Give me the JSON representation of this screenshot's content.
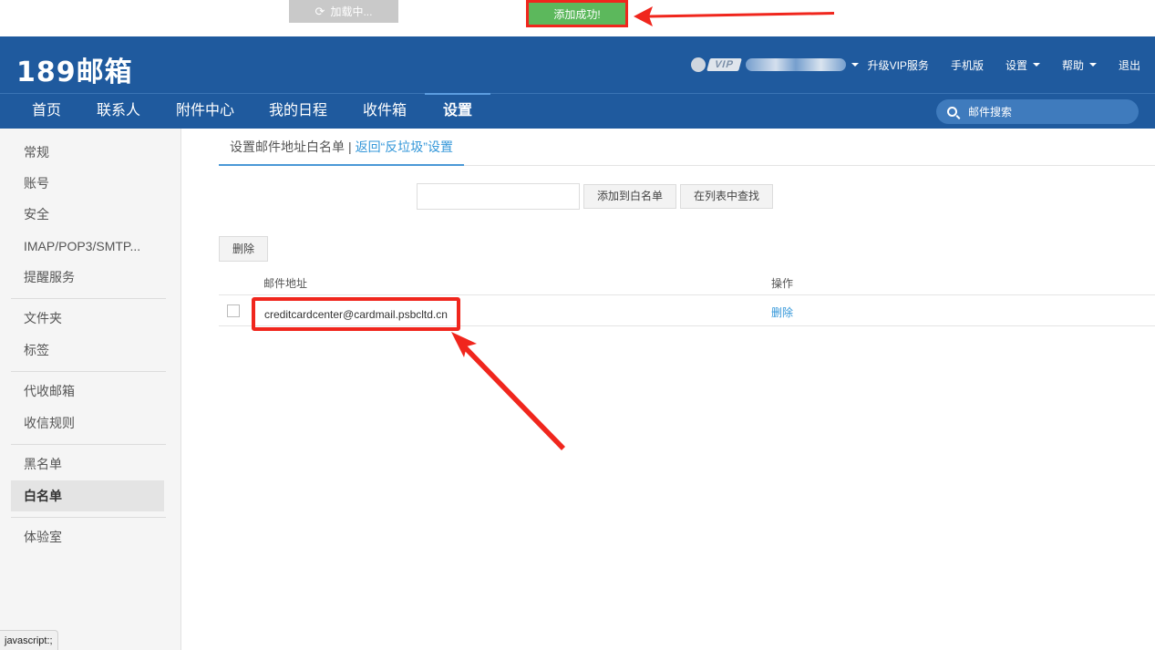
{
  "toast": {
    "loading": "加载中...",
    "success": "添加成功!"
  },
  "header": {
    "logo": "189邮箱",
    "vip_badge": "VIP",
    "links": [
      "升级VIP服务",
      "手机版",
      "设置",
      "帮助",
      "退出"
    ]
  },
  "nav": {
    "items": [
      "首页",
      "联系人",
      "附件中心",
      "我的日程",
      "收件箱",
      "设置"
    ],
    "search_placeholder": "邮件搜索"
  },
  "sidebar": {
    "items": [
      "常规",
      "账号",
      "安全",
      "IMAP/POP3/SMTP...",
      "提醒服务",
      "文件夹",
      "标签",
      "代收邮箱",
      "收信规则",
      "黑名单",
      "白名单",
      "体验室"
    ]
  },
  "main": {
    "tab_current": "设置邮件地址白名单",
    "tab_sep": "|",
    "tab_back": "返回“反垃圾”设置",
    "add_button": "添加到白名单",
    "find_button": "在列表中查找",
    "delete_button": "删除",
    "columns": [
      "邮件地址",
      "操作"
    ],
    "rows": [
      {
        "email": "creditcardcenter@cardmail.psbcltd.cn",
        "action": "删除"
      }
    ]
  },
  "statusbar": "javascript:;"
}
